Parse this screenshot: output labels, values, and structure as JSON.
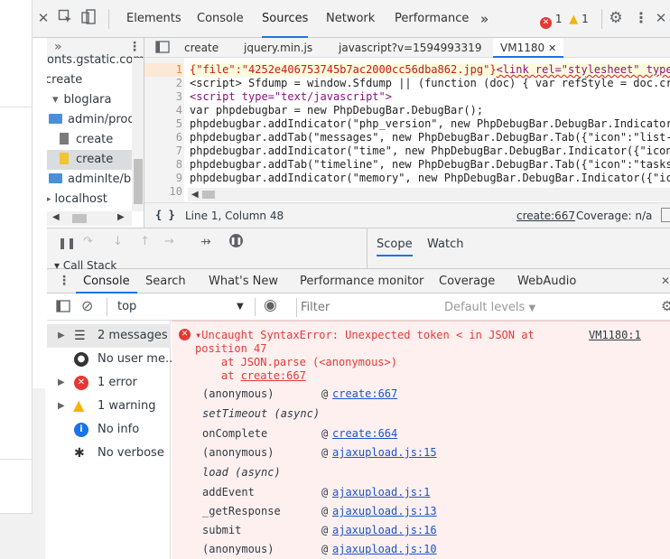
{
  "devtools_tabs": [
    "Elements",
    "Console",
    "Sources",
    "Network",
    "Performance"
  ],
  "more_tabs_glyph": "»",
  "error_count": "1",
  "warning_count": "1",
  "nav_tree": {
    "items": [
      {
        "label": "onts.gstatic.com"
      },
      {
        "label": "create"
      },
      {
        "label": "bloglara"
      },
      {
        "label": "admin/prod"
      },
      {
        "label": "create"
      },
      {
        "label": "create"
      },
      {
        "label": "adminlte/bo"
      },
      {
        "label": "localhost"
      }
    ]
  },
  "editor_tabs": [
    "create",
    "jquery.min.js",
    "javascript?v=1594993319",
    "VM1180"
  ],
  "code": {
    "line_numbers": [
      "1",
      "2",
      "3",
      "4",
      "5",
      "6",
      "7",
      "8",
      "9",
      "10"
    ],
    "l1a": "{\"file\":\"4252e406753745b7ac2000cc56dba862.jpg\"}",
    "l1b": "<link rel=\"stylesheet\" type",
    "l2": "<script> Sfdump = window.Sfdump || (function (doc) { var refStyle = doc.cr",
    "l3": "<script type=\"text/javascript\">",
    "l4": "var phpdebugbar = new PhpDebugBar.DebugBar();",
    "l5": "phpdebugbar.addIndicator(\"php_version\", new PhpDebugBar.DebugBar.Indicator",
    "l6": "phpdebugbar.addTab(\"messages\", new PhpDebugBar.DebugBar.Tab({\"icon\":\"list-",
    "l7": "phpdebugbar.addIndicator(\"time\", new PhpDebugBar.DebugBar.Indicator({\"icon",
    "l8": "phpdebugbar.addTab(\"timeline\", new PhpDebugBar.DebugBar.Tab({\"icon\":\"tasks",
    "l9": "phpdebugbar.addIndicator(\"memory\", new PhpDebugBar.DebugBar.Indicator({\"ic"
  },
  "status": {
    "format_glyph": "{ }",
    "position": "Line 1, Column 48",
    "source_link": "create:667",
    "coverage": "Coverage: n/a"
  },
  "debugger": {
    "call_stack": "Call Stack",
    "scope": "Scope",
    "watch": "Watch"
  },
  "drawer_tabs": [
    "Console",
    "Search",
    "What's New",
    "Performance monitor",
    "Coverage",
    "WebAudio"
  ],
  "console_toolbar": {
    "context": "top",
    "filter_placeholder": "Filter",
    "levels": "Default levels"
  },
  "sidebar": [
    {
      "label": "2 messages"
    },
    {
      "label": "No user me..."
    },
    {
      "label": "1 error"
    },
    {
      "label": "1 warning"
    },
    {
      "label": "No info"
    },
    {
      "label": "No verbose"
    }
  ],
  "error": {
    "line1": "▾Uncaught SyntaxError: Unexpected token < in JSON at",
    "line2": "position 47",
    "line3": "    at JSON.parse (<anonymous>)",
    "line4_prefix": "    at ",
    "line4_link": "create:667",
    "location": "VM1180:1"
  },
  "stack": [
    {
      "fn": "(anonymous)",
      "link": "create:667",
      "italic": false
    },
    {
      "fn": "setTimeout (async)",
      "link": "",
      "italic": true
    },
    {
      "fn": "onComplete",
      "link": "create:664",
      "italic": false
    },
    {
      "fn": "(anonymous)",
      "link": "ajaxupload.js:15",
      "italic": false
    },
    {
      "fn": "load (async)",
      "link": "",
      "italic": true
    },
    {
      "fn": "addEvent",
      "link": "ajaxupload.js:1",
      "italic": false
    },
    {
      "fn": "_getResponse",
      "link": "ajaxupload.js:13",
      "italic": false
    },
    {
      "fn": "submit",
      "link": "ajaxupload.js:16",
      "italic": false
    },
    {
      "fn": "(anonymous)",
      "link": "ajaxupload.js:10",
      "italic": false
    }
  ],
  "colors": {
    "accent": "#1a73e8",
    "error": "#e53935",
    "warning": "#f4b400",
    "info": "#1a73e8",
    "error_bg": "#fff0f0"
  }
}
